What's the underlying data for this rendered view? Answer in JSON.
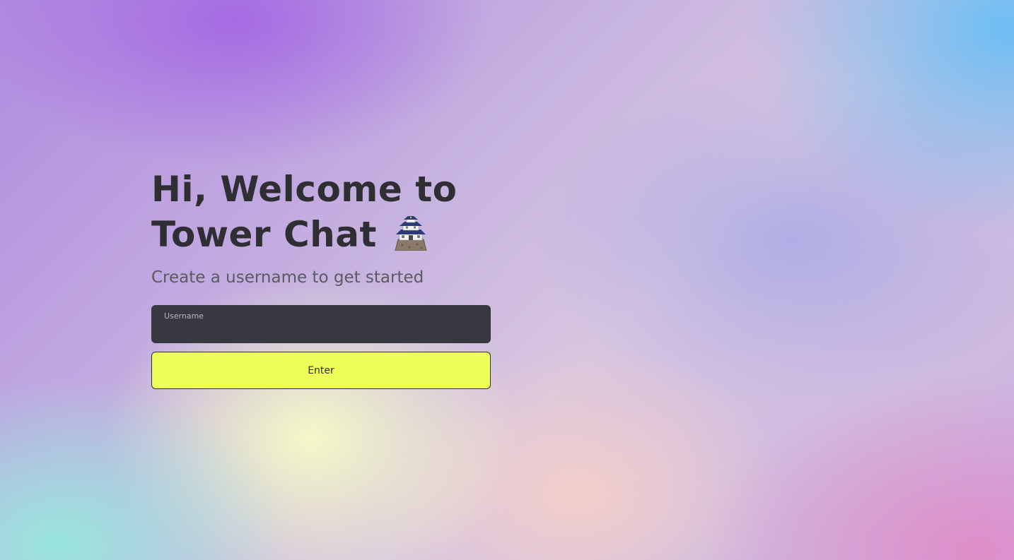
{
  "hero": {
    "title_line1": "Hi, Welcome to",
    "title_line2": "Tower Chat",
    "title_icon": "japanese-castle-icon",
    "subtitle": "Create a username to get started"
  },
  "form": {
    "username_label": "Username",
    "username_value": "",
    "enter_label": "Enter"
  },
  "colors": {
    "text_dark": "#2f2f33",
    "input_bg": "#373840",
    "button_accent": "#eeff5c"
  }
}
